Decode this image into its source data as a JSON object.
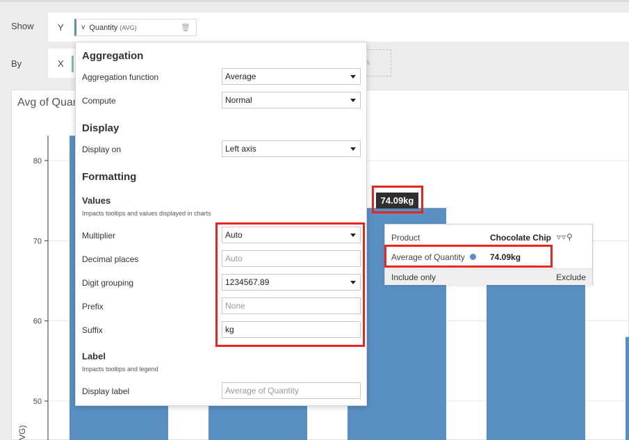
{
  "shelf": {
    "show_label": "Show",
    "by_label": "By",
    "y_letter": "Y",
    "x_letter": "X",
    "measure_name": "Quantity",
    "measure_agg": "(AVG)",
    "dropzone_text": "s"
  },
  "chart": {
    "title": "Avg of Quan",
    "y_ticks": [
      "80",
      "70",
      "60",
      "50"
    ],
    "y_axis_fragment": "VG)",
    "bar_color": "#5a8fc2",
    "highlight_value": "74.09kg"
  },
  "chart_data": {
    "type": "bar",
    "title": "Avg of Quan",
    "ylabel": "VG)",
    "ylim": [
      45,
      85
    ],
    "grid": true,
    "values": [
      83.1,
      74.09,
      71.9,
      58.0
    ]
  },
  "tooltip": {
    "product_label": "Product",
    "product_value": "Chocolate Chip",
    "metric_label": "Average of Quantity",
    "metric_value": "74.09kg",
    "include_label": "Include only",
    "exclude_label": "Exclude",
    "dot_color": "#5a8fc2"
  },
  "popover": {
    "aggregation_title": "Aggregation",
    "aggregation_function_label": "Aggregation function",
    "aggregation_function_value": "Average",
    "compute_label": "Compute",
    "compute_value": "Normal",
    "display_title": "Display",
    "display_on_label": "Display on",
    "display_on_value": "Left axis",
    "formatting_title": "Formatting",
    "values_title": "Values",
    "values_desc": "Impacts tooltips and values displayed in charts",
    "multiplier_label": "Multiplier",
    "multiplier_value": "Auto",
    "decimal_label": "Decimal places",
    "decimal_placeholder": "Auto",
    "digit_grouping_label": "Digit grouping",
    "digit_grouping_value": "1234567.89",
    "prefix_label": "Prefix",
    "prefix_placeholder": "None",
    "suffix_label": "Suffix",
    "suffix_value": "kg",
    "label_title": "Label",
    "label_desc": "Impacts tooltips and legend",
    "display_label_label": "Display label",
    "display_label_placeholder": "Average of Quantity"
  },
  "highlight_color": "#e8261c"
}
